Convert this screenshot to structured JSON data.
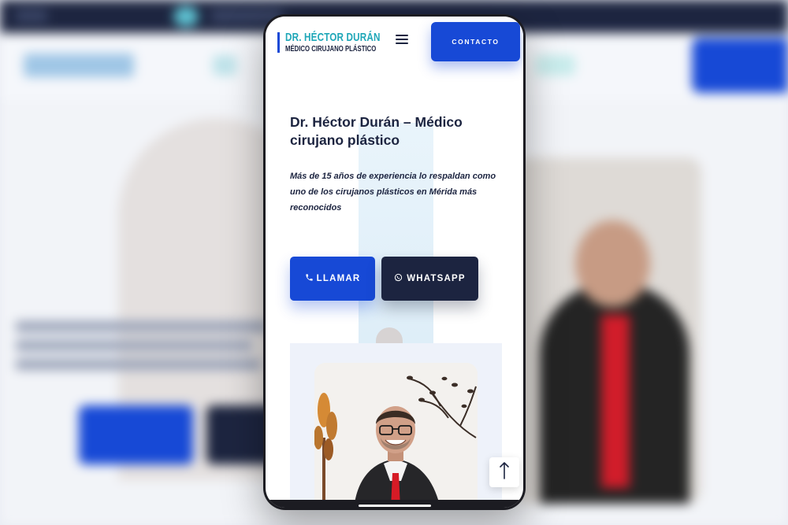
{
  "brand": {
    "name": "DR. HÉCTOR DURÁN",
    "tagline": "MÉDICO CIRUJANO PLÁSTICO"
  },
  "header": {
    "contact_label": "CONTACTO",
    "menu_icon": "hamburger-menu-icon"
  },
  "hero": {
    "title": "Dr. Héctor Durán – Médico cirujano plástico",
    "subtitle": "Más de 15 años de experiencia lo respaldan como uno de los cirujanos plásticos en Mérida más reconocidos",
    "call_button": {
      "icon": "phone-icon",
      "label": "LLAMAR"
    },
    "whatsapp_button": {
      "icon": "whatsapp-icon",
      "label": "WHATSAPP"
    }
  },
  "scroll_top": {
    "icon": "arrow-up-icon"
  },
  "colors": {
    "primary_blue": "#1749d6",
    "navy": "#1c2440",
    "teal": "#1fa7b8",
    "card_bg": "#eef2fa"
  }
}
